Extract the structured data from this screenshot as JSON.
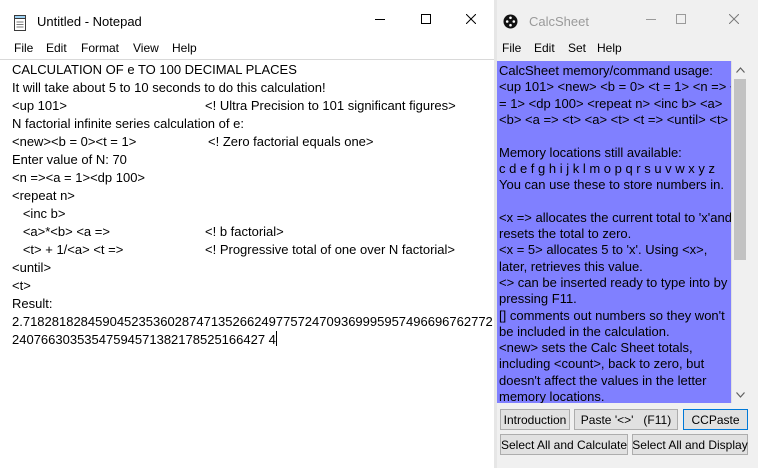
{
  "notepad": {
    "title": "Untitled - Notepad",
    "icon": "notepad-icon",
    "window_controls": [
      "minimize-icon",
      "maximize-icon",
      "close-icon"
    ],
    "menu": [
      "File",
      "Edit",
      "Format",
      "View",
      "Help"
    ],
    "lines": [
      {
        "text": "CALCULATION OF e TO 100 DECIMAL PLACES",
        "comment": ""
      },
      {
        "text": "It will take about 5 to 10 seconds to do this calculation!",
        "comment": ""
      },
      {
        "text": "<up 101>",
        "comment": "<! Ultra Precision to 101 significant figures>"
      },
      {
        "text": "N factorial infinite series calculation of e:",
        "comment": ""
      },
      {
        "text": "<new><b = 0><t = 1>",
        "comment": "<! Zero factorial equals one>"
      },
      {
        "text": "Enter value of N: 70",
        "comment": ""
      },
      {
        "text": "<n =><a = 1><dp 100>",
        "comment": ""
      },
      {
        "text": "<repeat n>",
        "comment": ""
      },
      {
        "text": "   <inc b>",
        "comment": ""
      },
      {
        "text": "   <a>*<b> <a =>",
        "comment": "<! b factorial>"
      },
      {
        "text": "   <t> + 1/<a> <t =>",
        "comment": "<! Progressive total of one over N factorial>"
      },
      {
        "text": "<until>",
        "comment": ""
      },
      {
        "text": "<t>",
        "comment": ""
      },
      {
        "text": "Result:",
        "comment": ""
      },
      {
        "text": "2.71828182845904523536028747135266249775724709369995957496696762772",
        "comment": ""
      },
      {
        "text": "24076630353547594571382178525166427 4",
        "comment": ""
      }
    ]
  },
  "calcsheet": {
    "title": "CalcSheet",
    "icon": "calcsheet-icon",
    "window_controls": [
      "minimize-icon",
      "maximize-icon",
      "close-icon"
    ],
    "menu": [
      "File",
      "Edit",
      "Set",
      "Help"
    ],
    "text_lines": [
      "CalcSheet memory/command usage:",
      "<up 101> <new> <b = 0> <t = 1> <n => <a",
      "= 1> <dp 100> <repeat n> <inc b> <a>",
      "<b> <a => <t> <a> <t> <t => <until> <t>",
      "",
      "Memory locations still available:",
      "c d e f g h i j k l m o p q r s u v w x y z",
      "You can use these to store numbers in.",
      "",
      "<x => allocates the current total to 'x'and",
      "resets the total to zero.",
      "<x = 5> allocates 5 to 'x'. Using <x>,",
      "later, retrieves this value.",
      "<> can be inserted ready to type into by",
      "pressing F11.",
      "[] comments out numbers so they won't",
      "be included in the calculation.",
      "<new> sets the Calc Sheet totals,",
      "including <count>, back to zero, but",
      "doesn't affect the values in the letter",
      "memory locations."
    ],
    "text_bg": "#8080ff",
    "buttons": {
      "introduction": "Introduction",
      "paste": "Paste '<>'   (F11)",
      "ccpaste": "CCPaste",
      "select_calc": "Select All and Calculate",
      "select_display": "Select All and Display"
    }
  }
}
